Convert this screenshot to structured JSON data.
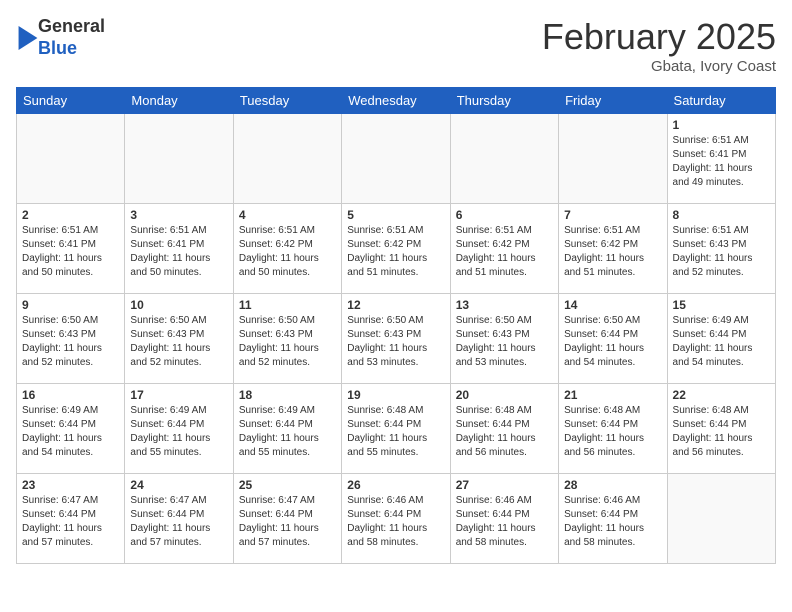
{
  "header": {
    "logo_general": "General",
    "logo_blue": "Blue",
    "month_title": "February 2025",
    "location": "Gbata, Ivory Coast"
  },
  "days_of_week": [
    "Sunday",
    "Monday",
    "Tuesday",
    "Wednesday",
    "Thursday",
    "Friday",
    "Saturday"
  ],
  "weeks": [
    [
      {
        "day": "",
        "info": ""
      },
      {
        "day": "",
        "info": ""
      },
      {
        "day": "",
        "info": ""
      },
      {
        "day": "",
        "info": ""
      },
      {
        "day": "",
        "info": ""
      },
      {
        "day": "",
        "info": ""
      },
      {
        "day": "1",
        "info": "Sunrise: 6:51 AM\nSunset: 6:41 PM\nDaylight: 11 hours\nand 49 minutes."
      }
    ],
    [
      {
        "day": "2",
        "info": "Sunrise: 6:51 AM\nSunset: 6:41 PM\nDaylight: 11 hours\nand 50 minutes."
      },
      {
        "day": "3",
        "info": "Sunrise: 6:51 AM\nSunset: 6:41 PM\nDaylight: 11 hours\nand 50 minutes."
      },
      {
        "day": "4",
        "info": "Sunrise: 6:51 AM\nSunset: 6:42 PM\nDaylight: 11 hours\nand 50 minutes."
      },
      {
        "day": "5",
        "info": "Sunrise: 6:51 AM\nSunset: 6:42 PM\nDaylight: 11 hours\nand 51 minutes."
      },
      {
        "day": "6",
        "info": "Sunrise: 6:51 AM\nSunset: 6:42 PM\nDaylight: 11 hours\nand 51 minutes."
      },
      {
        "day": "7",
        "info": "Sunrise: 6:51 AM\nSunset: 6:42 PM\nDaylight: 11 hours\nand 51 minutes."
      },
      {
        "day": "8",
        "info": "Sunrise: 6:51 AM\nSunset: 6:43 PM\nDaylight: 11 hours\nand 52 minutes."
      }
    ],
    [
      {
        "day": "9",
        "info": "Sunrise: 6:50 AM\nSunset: 6:43 PM\nDaylight: 11 hours\nand 52 minutes."
      },
      {
        "day": "10",
        "info": "Sunrise: 6:50 AM\nSunset: 6:43 PM\nDaylight: 11 hours\nand 52 minutes."
      },
      {
        "day": "11",
        "info": "Sunrise: 6:50 AM\nSunset: 6:43 PM\nDaylight: 11 hours\nand 52 minutes."
      },
      {
        "day": "12",
        "info": "Sunrise: 6:50 AM\nSunset: 6:43 PM\nDaylight: 11 hours\nand 53 minutes."
      },
      {
        "day": "13",
        "info": "Sunrise: 6:50 AM\nSunset: 6:43 PM\nDaylight: 11 hours\nand 53 minutes."
      },
      {
        "day": "14",
        "info": "Sunrise: 6:50 AM\nSunset: 6:44 PM\nDaylight: 11 hours\nand 54 minutes."
      },
      {
        "day": "15",
        "info": "Sunrise: 6:49 AM\nSunset: 6:44 PM\nDaylight: 11 hours\nand 54 minutes."
      }
    ],
    [
      {
        "day": "16",
        "info": "Sunrise: 6:49 AM\nSunset: 6:44 PM\nDaylight: 11 hours\nand 54 minutes."
      },
      {
        "day": "17",
        "info": "Sunrise: 6:49 AM\nSunset: 6:44 PM\nDaylight: 11 hours\nand 55 minutes."
      },
      {
        "day": "18",
        "info": "Sunrise: 6:49 AM\nSunset: 6:44 PM\nDaylight: 11 hours\nand 55 minutes."
      },
      {
        "day": "19",
        "info": "Sunrise: 6:48 AM\nSunset: 6:44 PM\nDaylight: 11 hours\nand 55 minutes."
      },
      {
        "day": "20",
        "info": "Sunrise: 6:48 AM\nSunset: 6:44 PM\nDaylight: 11 hours\nand 56 minutes."
      },
      {
        "day": "21",
        "info": "Sunrise: 6:48 AM\nSunset: 6:44 PM\nDaylight: 11 hours\nand 56 minutes."
      },
      {
        "day": "22",
        "info": "Sunrise: 6:48 AM\nSunset: 6:44 PM\nDaylight: 11 hours\nand 56 minutes."
      }
    ],
    [
      {
        "day": "23",
        "info": "Sunrise: 6:47 AM\nSunset: 6:44 PM\nDaylight: 11 hours\nand 57 minutes."
      },
      {
        "day": "24",
        "info": "Sunrise: 6:47 AM\nSunset: 6:44 PM\nDaylight: 11 hours\nand 57 minutes."
      },
      {
        "day": "25",
        "info": "Sunrise: 6:47 AM\nSunset: 6:44 PM\nDaylight: 11 hours\nand 57 minutes."
      },
      {
        "day": "26",
        "info": "Sunrise: 6:46 AM\nSunset: 6:44 PM\nDaylight: 11 hours\nand 58 minutes."
      },
      {
        "day": "27",
        "info": "Sunrise: 6:46 AM\nSunset: 6:44 PM\nDaylight: 11 hours\nand 58 minutes."
      },
      {
        "day": "28",
        "info": "Sunrise: 6:46 AM\nSunset: 6:44 PM\nDaylight: 11 hours\nand 58 minutes."
      },
      {
        "day": "",
        "info": ""
      }
    ]
  ]
}
